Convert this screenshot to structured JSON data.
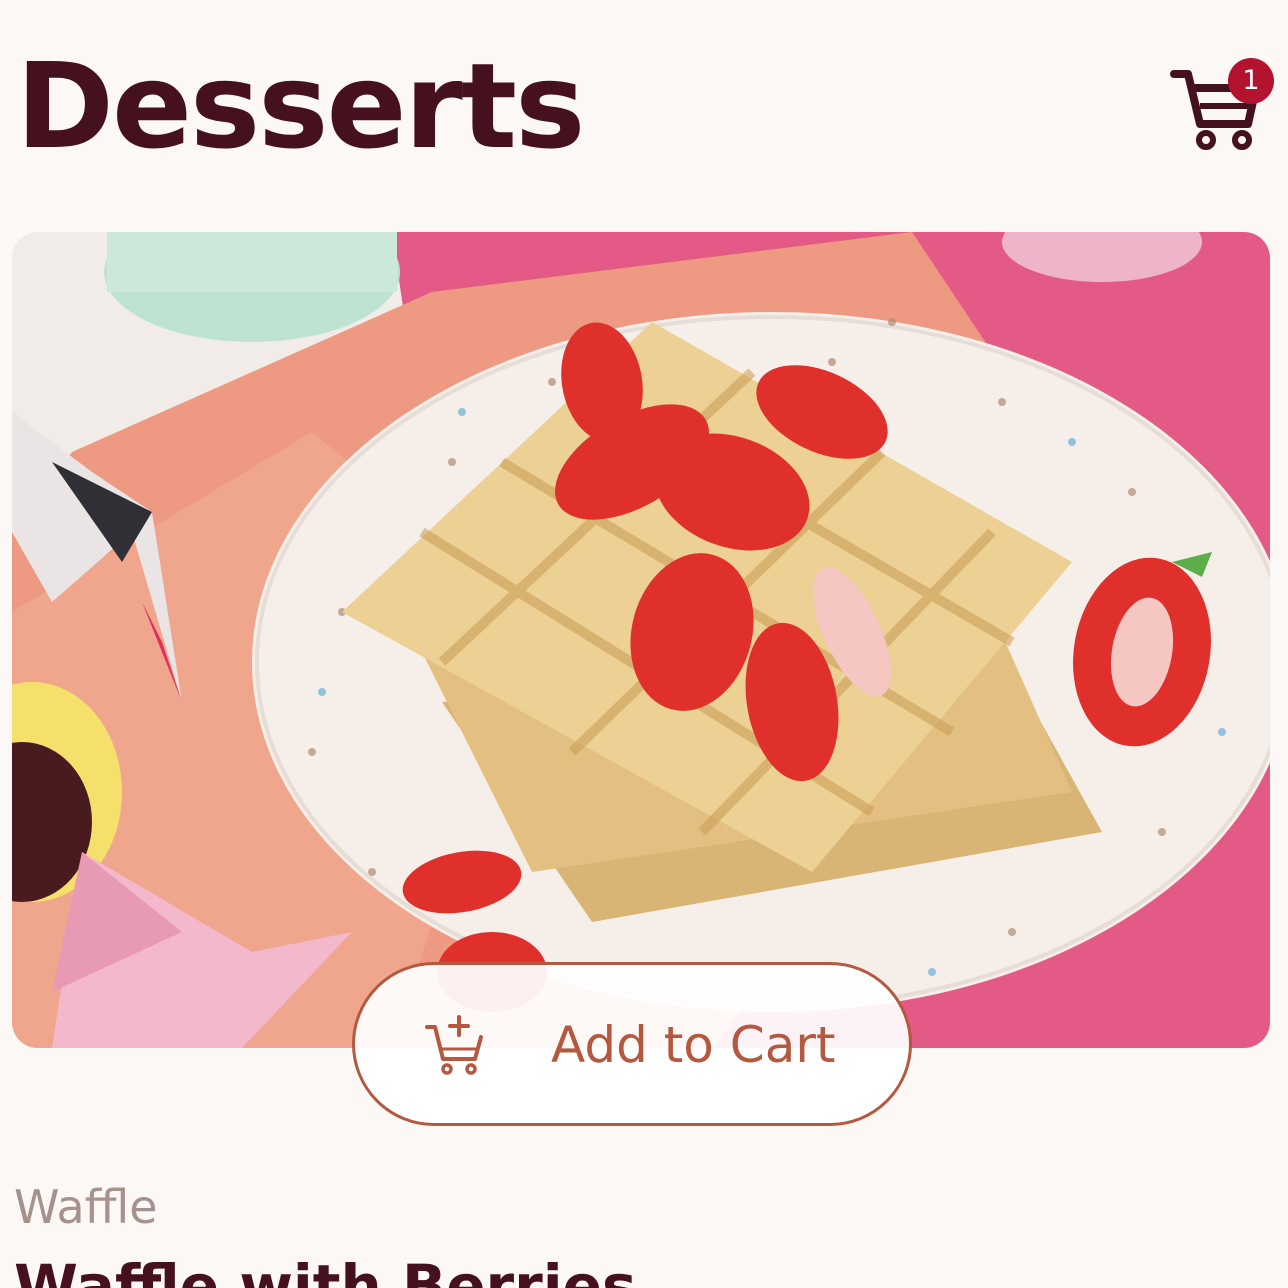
{
  "header": {
    "title": "Desserts",
    "cart": {
      "icon": "cart-icon",
      "badge_count": "1",
      "badge_color": "#b3132f"
    }
  },
  "product": {
    "image": "waffle-with-strawberries-photo",
    "add_to_cart": {
      "label": "Add to Cart",
      "icon": "cart-add-icon",
      "color": "#b4583f"
    },
    "category": "Waffle",
    "name": "Waffle with Berries"
  },
  "colors": {
    "title": "#45111c",
    "background": "#fcf8f6",
    "category_text": "#a6918d"
  }
}
